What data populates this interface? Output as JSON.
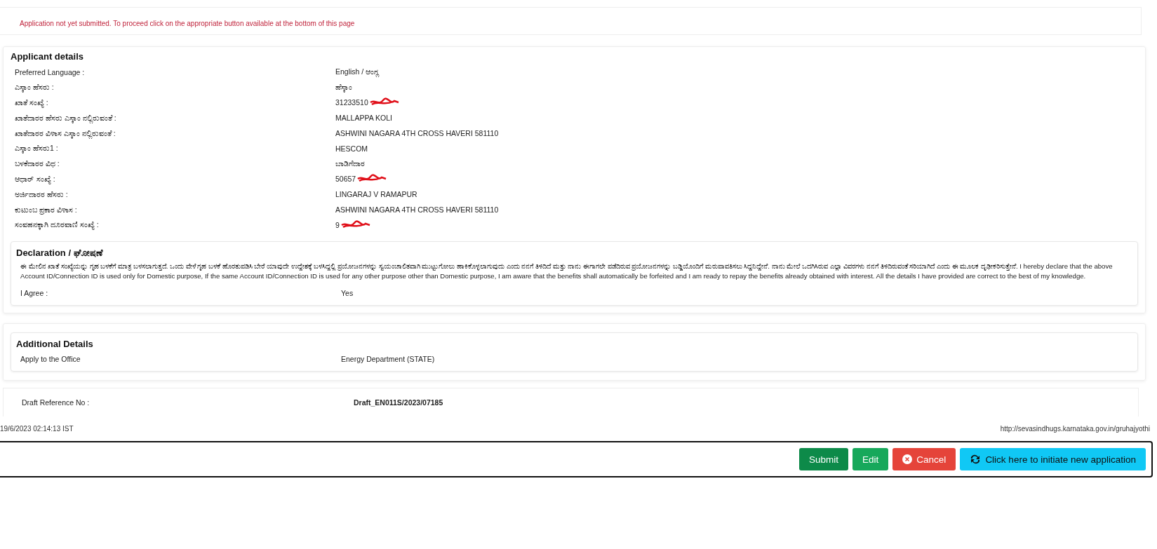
{
  "notice": "Application not yet submitted. To proceed click on the appropriate button available at the bottom of this page",
  "applicant_details": {
    "title": "Applicant details",
    "rows": [
      {
        "label": "Preferred Language :",
        "value": "English / ಆಂಗ್ಲ",
        "redacted": false
      },
      {
        "label": "ಎಸ್ಕಾಂ ಹೆಸರು :",
        "value": "ಹೆಸ್ಕಾಂ",
        "redacted": false
      },
      {
        "label": "ಖಾತೆ ಸಂಖ್ಯೆ :",
        "value": "31233510",
        "redacted": true
      },
      {
        "label": "ಖಾತೆದಾರರ ಹೆಸರು ಎಸ್ಕಾಂ ನಲ್ಲಿರುವಂತೆ :",
        "value": "MALLAPPA KOLI",
        "redacted": false
      },
      {
        "label": "ಖಾತೆದಾರರ ವಿಳಾಸ ಎಸ್ಕಾಂ ನಲ್ಲಿರುವಂತೆ :",
        "value": "ASHWINI NAGARA 4TH CROSS HAVERI 581110",
        "redacted": false
      },
      {
        "label": "ಎಸ್ಕಾಂ ಹೆಸರು1 :",
        "value": "HESCOM",
        "redacted": false
      },
      {
        "label": "ಬಳಕೆದಾರರ ವಿಧ :",
        "value": "ಬಾಡಿಗೆದಾರ",
        "redacted": false
      },
      {
        "label": "ಆಧಾರ್ ಸಂಖ್ಯೆ :",
        "value": "50657",
        "redacted": true
      },
      {
        "label": "ಅರ್ಜಿದಾರರ ಹೆಸರು :",
        "value": "LINGARAJ V RAMAPUR",
        "redacted": false
      },
      {
        "label": "ಕುಟುಂಬ ಪ್ರಕಾರ ವಿಳಾಸ :",
        "value": "ASHWINI NAGARA 4TH CROSS HAVERI 581110",
        "redacted": false
      },
      {
        "label": "ಸಂವಹನಕ್ಕಾಗಿ ದೂರವಾಣಿ ಸಂಖ್ಯೆ :",
        "value": "9",
        "redacted": true
      }
    ]
  },
  "declaration": {
    "title": "Declaration / ಘೋಷಣೆ",
    "text": "ಈ ಮೇಲಿನ ಖಾತೆ ಸಂಖ್ಯೆಯನ್ನು ಗೃಹ ಬಳಕೆಗೆ ಮಾತ್ರ ಬಳಸಲಾಗುತ್ತದೆ. ಒಂದು ವೇಳೆ ಗೃಹ ಬಳಕೆ ಹೊರತುಪಡಿಸಿ ಬೇರೆ ಯಾವುದೇ ಉದ್ದೇಶಕ್ಕೆ ಬಳಸಿದ್ದಲ್ಲಿ ಪ್ರಯೋಜನಗಳನ್ನು ಸ್ವಯಂಚಾಲಿತವಾಗಿ ಮುಟ್ಟುಗೋಲು ಹಾಕಿಕೊಳ್ಳಲಾಗುವುದು ಎಂದು ನನಗೆ ತಿಳಿದಿದೆ ಮತ್ತು ನಾನು ಈಗಾಗಲೇ ಪಡೆದಿರುವ ಪ್ರಯೋಜನಗಳನ್ನು ಬಡ್ಡಿಯೊಂದಿಗೆ ಮರುಪಾವತಿಸಲು ಸಿದ್ಧನಿದ್ದೇನೆ. ನಾನು ಮೇಲೆ ಒದಗಿಸಿರುವ ಎಲ್ಲಾ ವಿವರಗಳು ನನಗೆ ತಿಳಿದಿರುವಂತೆ ಸರಿಯಾಗಿದೆ ಎಂದು ಈ ಮೂಲಕ ದೃಢೀಕರಿಸುತ್ತೇನೆ. I hereby declare that the above Account ID/Connection ID is used only for Domestic purpose, If the same Account ID/Connection ID is used for any other purpose other than Domestic purpose, I am aware that the benefits shall automatically be forfeited and I am ready to repay the benefits already obtained with interest. All the details I have provided are correct to the best of my knowledge.",
    "agree_label": "I Agree :",
    "agree_value": "Yes"
  },
  "additional_details": {
    "title": "Additional Details",
    "rows": [
      {
        "label": "Apply to the Office",
        "value": "Energy Department (STATE)"
      }
    ]
  },
  "draft_reference": {
    "label": "Draft Reference No :",
    "value": "Draft_EN011S/2023/07185"
  },
  "footer": {
    "timestamp": "19/6/2023 02:14:13 IST",
    "url": "http://sevasindhugs.karnataka.gov.in/gruhajyothi"
  },
  "buttons": [
    {
      "label": "Submit",
      "kind": "submit"
    },
    {
      "label": "Edit",
      "kind": "edit"
    },
    {
      "label": "Cancel",
      "kind": "cancel"
    },
    {
      "label": "Click here to initiate new application",
      "kind": "new"
    }
  ]
}
